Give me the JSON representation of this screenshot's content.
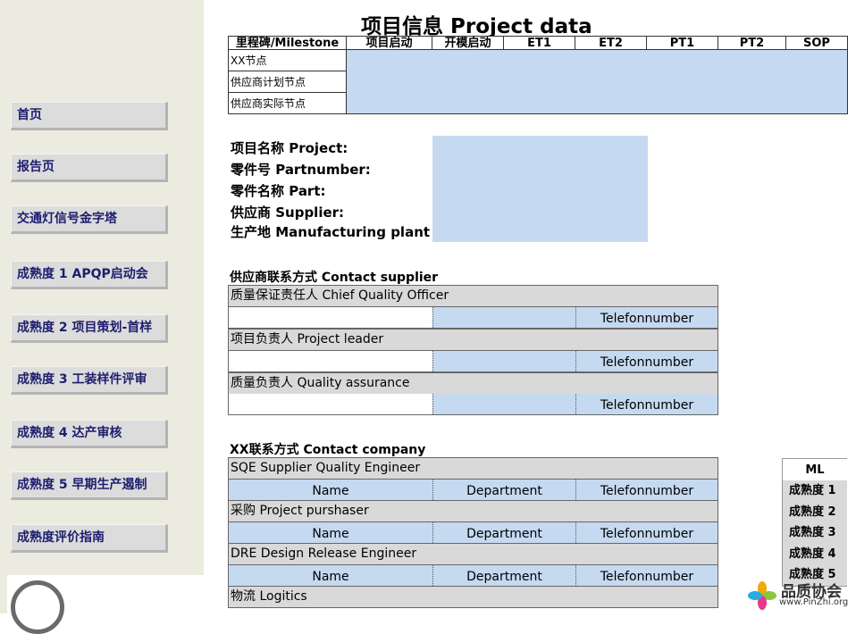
{
  "title": "项目信息 Project data",
  "sidebar": {
    "items": [
      {
        "label": "首页"
      },
      {
        "label": "报告页"
      },
      {
        "label": "交通灯信号金字塔"
      },
      {
        "label": "成熟度 1 APQP启动会"
      },
      {
        "label": "成熟度 2 项目策划-首样"
      },
      {
        "label": "成熟度 3 工装样件评审"
      },
      {
        "label": "成熟度 4 达产审核"
      },
      {
        "label": "成熟度 5 早期生产遏制"
      },
      {
        "label": "成熟度评价指南"
      }
    ]
  },
  "milestones": {
    "headers": [
      "里程碑/Milestone",
      "项目启动",
      "开模启动",
      "ET1",
      "ET2",
      "PT1",
      "PT2",
      "SOP"
    ],
    "rows": [
      "XX节点",
      "供应商计划节点",
      "供应商实际节点"
    ]
  },
  "project_info": {
    "labels": [
      "项目名称 Project:",
      "零件号 Partnumber:",
      "零件名称 Part:",
      "供应商 Supplier:",
      "生产地 Manufacturing plant"
    ]
  },
  "contact_supplier": {
    "title": "供应商联系方式 Contact supplier",
    "roles": [
      {
        "label": "质量保证责任人 Chief Quality Officer",
        "phone": "Telefonnumber"
      },
      {
        "label": "项目负责人 Project leader",
        "phone": "Telefonnumber"
      },
      {
        "label": "质量负责人 Quality assurance",
        "phone": "Telefonnumber"
      }
    ]
  },
  "contact_company": {
    "title": "XX联系方式 Contact company",
    "roles": [
      {
        "label": "SQE Supplier Quality Engineer",
        "name": "Name",
        "dept": "Department",
        "phone": "Telefonnumber"
      },
      {
        "label": "采购 Project purshaser",
        "name": "Name",
        "dept": "Department",
        "phone": "Telefonnumber"
      },
      {
        "label": "DRE Design Release Engineer",
        "name": "Name",
        "dept": "Department",
        "phone": "Telefonnumber"
      },
      {
        "label": "物流 Logitics"
      }
    ]
  },
  "ml_legend": {
    "header": "ML",
    "items": [
      "成熟度 1",
      "成熟度 2",
      "成熟度 3",
      "成熟度 4",
      "成熟度 5"
    ]
  },
  "watermark": {
    "text": "品质协会",
    "url": "www.PinZhi.org"
  },
  "colors": {
    "input_fill": "#c5d9f1",
    "label_gray": "#d9d9d9",
    "sidebar_bg": "#ecebe0",
    "nav_text": "#1d1d6e"
  }
}
